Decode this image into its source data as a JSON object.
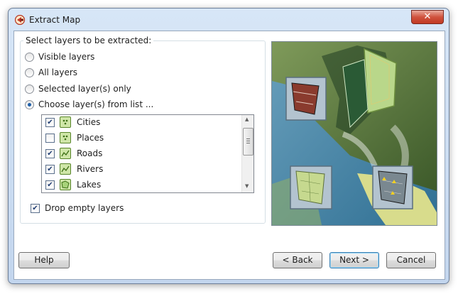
{
  "window": {
    "title": "Extract Map",
    "close_glyph": "✕"
  },
  "group": {
    "label": "Select layers to be extracted:",
    "options": [
      {
        "label": "Visible layers",
        "selected": false
      },
      {
        "label": "All layers",
        "selected": false
      },
      {
        "label": "Selected layer(s) only",
        "selected": false
      },
      {
        "label": "Choose layer(s) from list ...",
        "selected": true
      }
    ],
    "layers": [
      {
        "label": "Cities",
        "checked": true,
        "icon": "point-layer-icon"
      },
      {
        "label": "Places",
        "checked": false,
        "icon": "point-layer-icon"
      },
      {
        "label": "Roads",
        "checked": true,
        "icon": "line-layer-icon"
      },
      {
        "label": "Rivers",
        "checked": true,
        "icon": "line-layer-icon"
      },
      {
        "label": "Lakes",
        "checked": true,
        "icon": "polygon-layer-icon"
      }
    ],
    "drop_empty": {
      "label": "Drop empty layers",
      "checked": true
    }
  },
  "buttons": {
    "help": "Help",
    "back": "< Back",
    "next": "Next >",
    "cancel": "Cancel"
  },
  "check_glyph": "✔",
  "colors": {
    "accent": "#3c7fb1",
    "close_red": "#c13a24",
    "layer_icon_green": "#58852a"
  }
}
